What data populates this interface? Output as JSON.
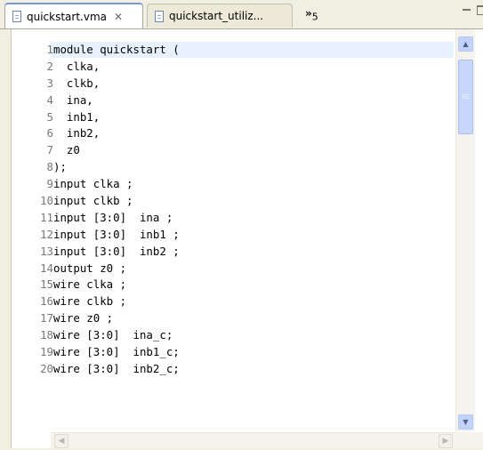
{
  "tabs": [
    {
      "label": "quickstart.vma",
      "active": true,
      "close_glyph": "✕"
    },
    {
      "label": "quickstart_utiliz...",
      "active": false
    }
  ],
  "overflow": {
    "glyph": "»",
    "count": "5"
  },
  "icons": {
    "tab_file": "document-icon",
    "scroll_up": "arrow-up-icon",
    "scroll_down": "arrow-down-icon",
    "scroll_left": "arrow-left-icon",
    "scroll_right": "arrow-right-icon"
  },
  "colors": {
    "current_line": "#e8f2fe",
    "line_numbers": "#787878",
    "active_tab_border": "#7a96df",
    "scrollbar": "#c1d3fb"
  },
  "editor": {
    "lines": [
      {
        "n": "1",
        "text": "module quickstart ("
      },
      {
        "n": "2",
        "text": "  clka,"
      },
      {
        "n": "3",
        "text": "  clkb,"
      },
      {
        "n": "4",
        "text": "  ina,"
      },
      {
        "n": "5",
        "text": "  inb1,"
      },
      {
        "n": "6",
        "text": "  inb2,"
      },
      {
        "n": "7",
        "text": "  z0"
      },
      {
        "n": "8",
        "text": ");"
      },
      {
        "n": "9",
        "text": "input clka ;"
      },
      {
        "n": "10",
        "text": "input clkb ;"
      },
      {
        "n": "11",
        "text": "input [3:0]  ina ;"
      },
      {
        "n": "12",
        "text": "input [3:0]  inb1 ;"
      },
      {
        "n": "13",
        "text": "input [3:0]  inb2 ;"
      },
      {
        "n": "14",
        "text": "output z0 ;"
      },
      {
        "n": "15",
        "text": "wire clka ;"
      },
      {
        "n": "16",
        "text": "wire clkb ;"
      },
      {
        "n": "17",
        "text": "wire z0 ;"
      },
      {
        "n": "18",
        "text": "wire [3:0]  ina_c;"
      },
      {
        "n": "19",
        "text": "wire [3:0]  inb1_c;"
      },
      {
        "n": "20",
        "text": "wire [3:0]  inb2_c;"
      }
    ]
  }
}
